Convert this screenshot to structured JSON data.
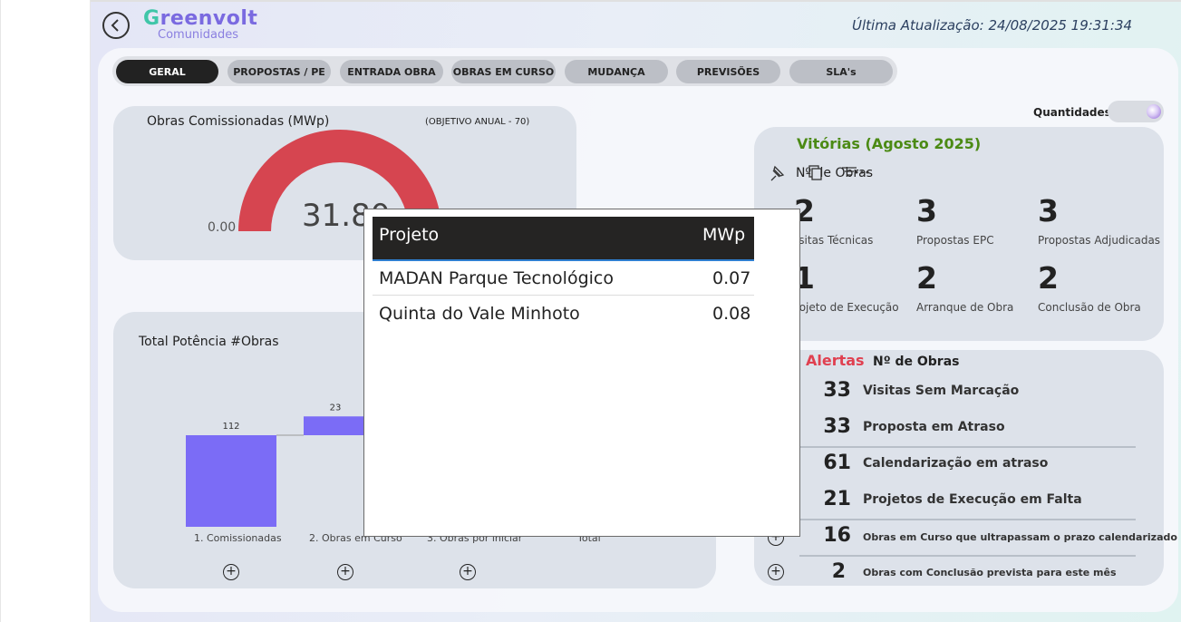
{
  "header": {
    "logo_main_prefix": "G",
    "logo_main_rest": "reenvolt",
    "logo_sub": "Comunidades",
    "updated": "Última Atualização: 24/08/2025 19:31:34"
  },
  "tabs": [
    {
      "label": "GERAL",
      "active": true
    },
    {
      "label": "PROPOSTAS / PE",
      "active": false
    },
    {
      "label": "ENTRADA OBRA",
      "active": false
    },
    {
      "label": "OBRAS EM CURSO",
      "active": false
    },
    {
      "label": "MUDANÇA",
      "active": false
    },
    {
      "label": "PREVISÕES",
      "active": false
    },
    {
      "label": "SLA's",
      "active": false
    }
  ],
  "gauge": {
    "title": "Obras Comissionadas (MWp)",
    "objective": "(OBJETIVO ANUAL - 70)",
    "min": "0.00",
    "value": "31.80",
    "value_num": 31.8,
    "max_num": 70,
    "color": "#d64550"
  },
  "toggle": {
    "label": "Quantidades"
  },
  "vitorias": {
    "title": "Vitórias (Agosto 2025)",
    "subtitle": "Nº de Obras",
    "items": [
      {
        "value": "2",
        "label": "Visitas Técnicas"
      },
      {
        "value": "3",
        "label": "Propostas EPC"
      },
      {
        "value": "3",
        "label": "Propostas Adjudicadas"
      },
      {
        "value": "1",
        "label": "Projeto de Execução"
      },
      {
        "value": "2",
        "label": "Arranque de Obra"
      },
      {
        "value": "2",
        "label": "Conclusão de Obra"
      }
    ]
  },
  "alertas": {
    "title": "Alertas",
    "subtitle": "Nº de Obras",
    "items": [
      {
        "value": "33",
        "label": "Visitas Sem Marcação"
      },
      {
        "value": "33",
        "label": "Proposta em Atraso"
      },
      {
        "value": "61",
        "label": "Calendarização em atraso"
      },
      {
        "value": "21",
        "label": "Projetos de Execução em Falta"
      },
      {
        "value": "16",
        "label": "Obras em Curso que ultrapassam o prazo calendarizado"
      },
      {
        "value": "2",
        "label": "Obras com Conclusão prevista para este mês"
      }
    ]
  },
  "waterfall": {
    "title": "Total Potência #Obras",
    "color": "#7b6cf6"
  },
  "chart_data": {
    "type": "bar",
    "categories": [
      "1. Comissionadas",
      "2. Obras em Curso",
      "3. Obras por iniciar",
      "Total"
    ],
    "values": [
      112,
      23
    ],
    "xlabel": "",
    "ylabel": ""
  },
  "popup": {
    "headers": {
      "project": "Projeto",
      "mwp": "MWp"
    },
    "rows": [
      {
        "project": "MADAN Parque Tecnológico",
        "mwp": "0.07"
      },
      {
        "project": "Quinta do Vale Minhoto",
        "mwp": "0.08"
      }
    ]
  }
}
